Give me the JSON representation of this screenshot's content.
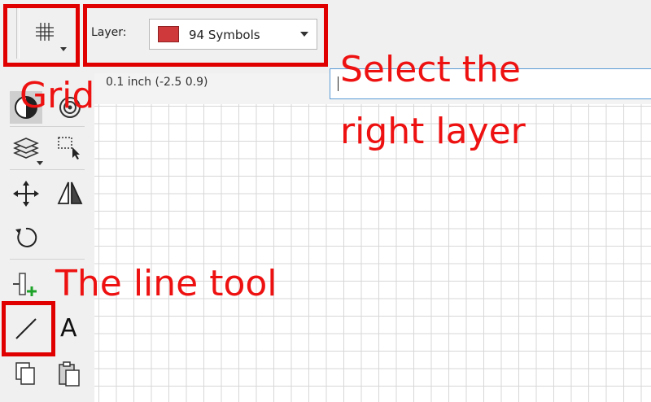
{
  "toolbar": {
    "layer_label": "Layer:",
    "layer_value": "94 Symbols",
    "layer_color": "#d0393b",
    "grid_button_icon": "grid-icon"
  },
  "status": {
    "coordinate_text": "0.1 inch (-2.5 0.9)",
    "command_value": ""
  },
  "tools": {
    "icons": [
      "view-mode-icon",
      "snap-target-icon",
      "layers-icon",
      "selection-rectangle-icon",
      "move-icon",
      "mirror-icon",
      "rotate-icon",
      "add-pin-icon",
      "line-icon",
      "text-icon",
      "copy-icon",
      "paste-icon"
    ],
    "text_tool_glyph": "A"
  },
  "annotations": {
    "grid": "Grid",
    "layer_line1": "Select the",
    "layer_line2": "right layer",
    "line_tool": "The line tool",
    "color": "#ee1111"
  }
}
